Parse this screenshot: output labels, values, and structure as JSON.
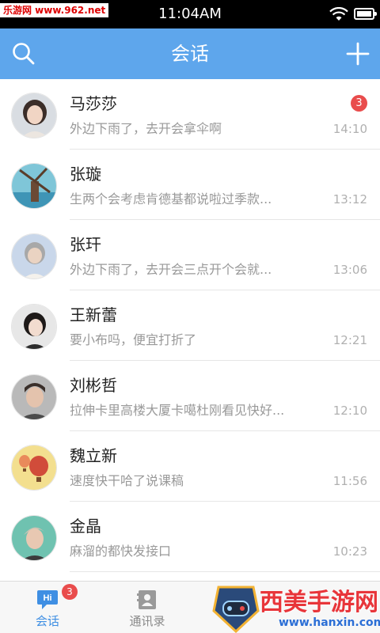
{
  "watermark": {
    "site": "乐游网 www.962.net",
    "brand_text": "西美手游网",
    "brand_sub": "www.hanxin.com"
  },
  "status_bar": {
    "time": "11:04AM"
  },
  "header": {
    "title": "会话"
  },
  "conversations": [
    {
      "name": "马莎莎",
      "message": "外边下雨了，去开会拿伞啊",
      "time": "14:10",
      "unread": "3"
    },
    {
      "name": "张璇",
      "message": "生两个会考虑肯德基都说啦过季款...",
      "time": "13:12"
    },
    {
      "name": "张玕",
      "message": "外边下雨了，去开会三点开个会就...",
      "time": "13:06"
    },
    {
      "name": "王新蕾",
      "message": "要小布吗，便宜打折了",
      "time": "12:21"
    },
    {
      "name": "刘彬哲",
      "message": "拉伸卡里高楼大厦卡噶杜刚看见快好...",
      "time": "12:10"
    },
    {
      "name": "魏立新",
      "message": "速度快干哈了说课稿",
      "time": "11:56"
    },
    {
      "name": "金晶",
      "message": "麻溜的都快发接口",
      "time": "10:23"
    }
  ],
  "bottom_nav": {
    "items": [
      {
        "label": "会话",
        "badge": "3",
        "icon": "chat-icon",
        "active": true
      },
      {
        "label": "通讯录",
        "icon": "contacts-icon",
        "active": false
      }
    ]
  },
  "colors": {
    "header": "#5ea6ec",
    "badge": "#e94c4c",
    "active_tab": "#3f8fe3",
    "inactive_tab": "#8a8a8a"
  }
}
